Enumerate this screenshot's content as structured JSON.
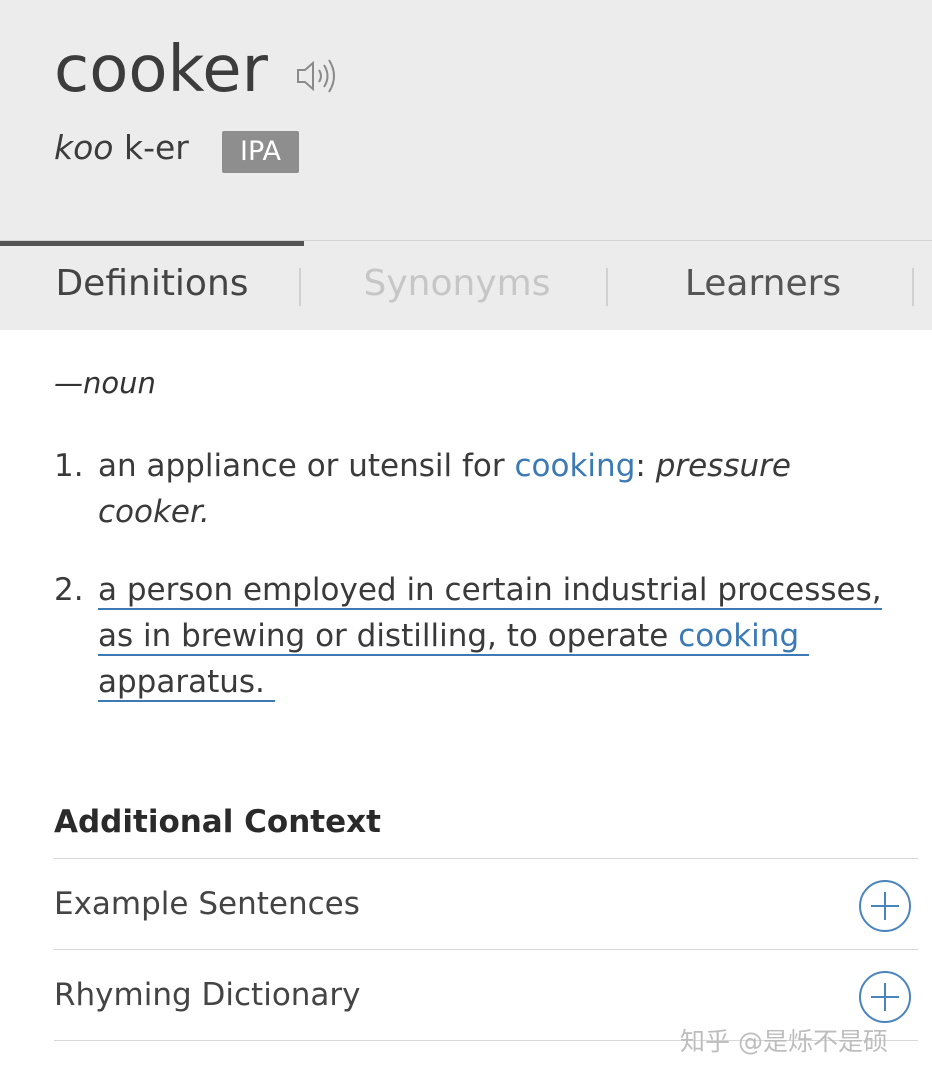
{
  "header": {
    "word": "cooker",
    "pronunciation_stressed": "koo",
    "pronunciation_rest": " k-er",
    "ipa_label": "IPA",
    "speaker_icon": "speaker-icon"
  },
  "tabs": [
    {
      "label": "Definitions",
      "state": "active"
    },
    {
      "label": "Synonyms",
      "state": "disabled"
    },
    {
      "label": "Learners",
      "state": "normal"
    }
  ],
  "definitions": {
    "part_of_speech": "—noun",
    "items": [
      {
        "number": "1.",
        "text_before_link": "an appliance or utensil for ",
        "link": "cooking",
        "text_after_link": ": ",
        "example_line1": "pressure",
        "example_line2": "cooker."
      },
      {
        "number": "2.",
        "line1": "a person employed in certain industrial processes,",
        "line2_before_link": "as in brewing or distilling, to operate ",
        "line2_link": "cooking",
        "line3": "apparatus."
      }
    ]
  },
  "additional_context": {
    "title": "Additional Context",
    "rows": [
      {
        "label": "Example Sentences",
        "icon": "plus-circle-icon"
      },
      {
        "label": "Rhyming Dictionary",
        "icon": "plus-circle-icon"
      }
    ]
  },
  "watermark": "知乎 @是烁不是硕",
  "colors": {
    "header_bg": "#ececec",
    "link": "#3c7ab5",
    "ipa_badge": "#8e8e8e"
  }
}
